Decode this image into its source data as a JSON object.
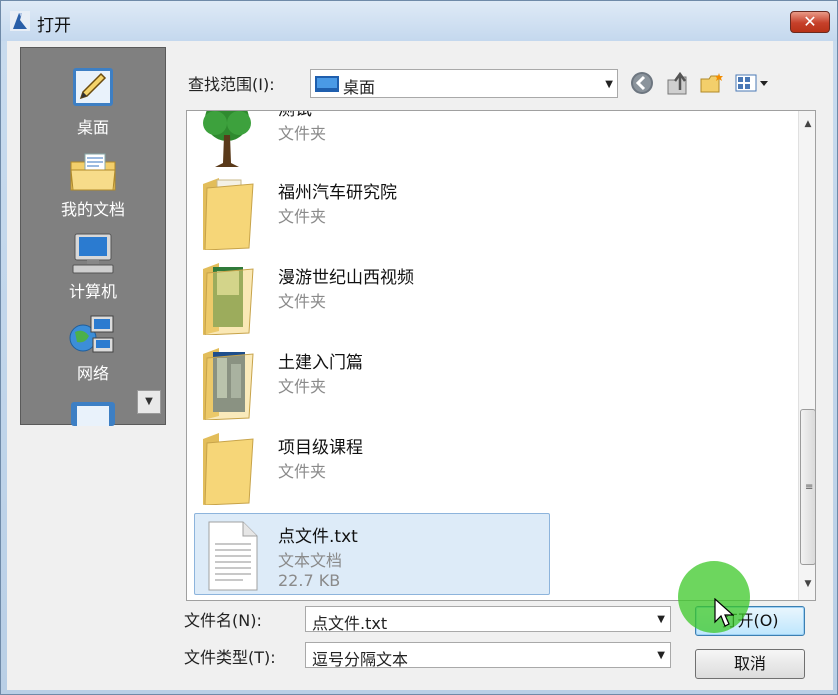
{
  "window": {
    "title": "打开",
    "close_label": "✕"
  },
  "places": [
    {
      "label": "桌面",
      "icon": "desktop-pen-icon"
    },
    {
      "label": "我的文档",
      "icon": "my-documents-folder-icon"
    },
    {
      "label": "计算机",
      "icon": "computer-icon"
    },
    {
      "label": "网络",
      "icon": "network-icon"
    }
  ],
  "lookin": {
    "label": "查找范围(I):",
    "value": "桌面"
  },
  "files": [
    {
      "name": "测试",
      "type": "文件夹",
      "icon": "tree-icon"
    },
    {
      "name": "福州汽车研究院",
      "type": "文件夹",
      "icon": "folder-icon"
    },
    {
      "name": "漫游世纪山西视频",
      "type": "文件夹",
      "icon": "folder-icon"
    },
    {
      "name": "土建入门篇",
      "type": "文件夹",
      "icon": "folder-icon"
    },
    {
      "name": "项目级课程",
      "type": "文件夹",
      "icon": "folder-icon"
    },
    {
      "name": "点文件.txt",
      "type": "文本文档",
      "size": "22.7 KB",
      "icon": "text-file-icon",
      "selected": true
    }
  ],
  "filename": {
    "label": "文件名(N):",
    "value": "点文件.txt"
  },
  "filetype": {
    "label": "文件类型(T):",
    "value": "逗号分隔文本"
  },
  "buttons": {
    "open": "打开(O)",
    "cancel": "取消"
  },
  "colors": {
    "selection_bg": "#ddebf8",
    "places_bg": "#808080",
    "close_red": "#c6402a",
    "click_indicator": "#3cc828"
  }
}
